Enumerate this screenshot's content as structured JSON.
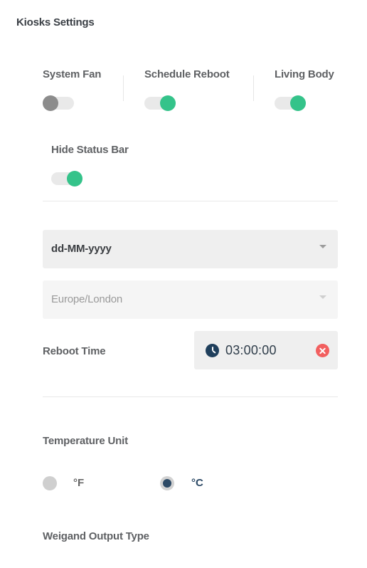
{
  "header": {
    "title": "Kiosks Settings"
  },
  "toggles": [
    {
      "label": "System Fan",
      "on": false
    },
    {
      "label": "Schedule Reboot",
      "on": true
    },
    {
      "label": "Living Body",
      "on": true
    },
    {
      "label": "Hide Status Bar",
      "on": true
    }
  ],
  "date_format": {
    "value": "dd-MM-yyyy"
  },
  "timezone": {
    "value": "Europe/London",
    "disabled": true
  },
  "reboot_time": {
    "label": "Reboot Time",
    "value": "03:00:00"
  },
  "temperature": {
    "label": "Temperature Unit",
    "options": [
      {
        "label": "°F",
        "selected": false
      },
      {
        "label": "°C",
        "selected": true
      }
    ]
  },
  "weigand": {
    "label": "Weigand Output Type"
  },
  "colors": {
    "accent": "#34c38a",
    "primary": "#2d4a66",
    "danger": "#f25f5f"
  }
}
